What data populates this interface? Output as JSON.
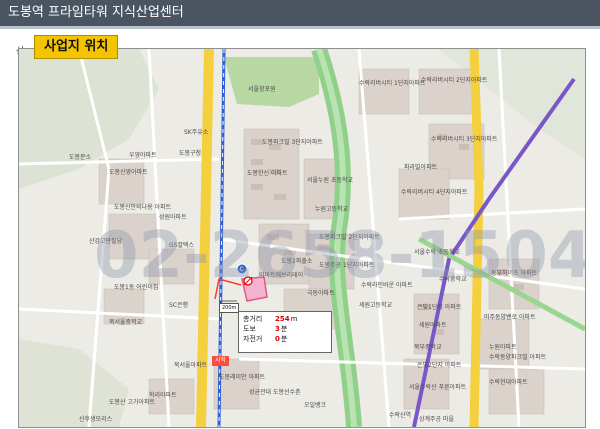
{
  "header": {
    "title": "도봉역 프라임타워 지식산업센터",
    "section_label": "사업지 위치",
    "frame_label": "상"
  },
  "map": {
    "watermark": "02-2658-1504",
    "scale_label": "200m",
    "start_label": "시작",
    "colors": {
      "stream": "#8fd08a",
      "main_road": "#f4d03f",
      "subway_line": "#7a57c8",
      "rail_line": "#2d5fd6",
      "site": "#e0568f"
    },
    "labels": {
      "park": "서울창포원",
      "apt_top_right_1": "수락리버시티 1단지아파트",
      "apt_top_right_2": "수락리버시티 2단지아파트",
      "apt_right_3": "수락리버시티 3단지아파트",
      "apt_right_4": "수락리버시티 4단지아파트",
      "park_apt": "파라빌아파트",
      "school_right": "서울수락 초등학교",
      "dobong_pakr": "도봉파크빌 3단지아파트",
      "dobong_hanshin": "도봉한신 아파트",
      "seoul_dobong": "서울누원 초등학교",
      "nuwon_high": "누원고등학교",
      "dobong_park2": "도봉파크빌 2단지아파트",
      "dobong_station": "도봉2파출소",
      "dobong_jugong": "도봉주공 1단지아파트",
      "emart": "이마트에브리데이",
      "geukdong": "극동아파트",
      "uyeon": "우영아파트",
      "dobong_gu": "도봉구청",
      "sk": "SK주유소",
      "dobong_sinyeong": "도봉신영아파트",
      "dobong_meadow": "도봉신안비나용 아파트",
      "seongwon": "성원아파트",
      "gs": "GS칼텍스",
      "sanggye": "산강고판필당",
      "dobong1": "도봉1동 어린이집",
      "sc": "SC은행",
      "bukseoul": "북서울중학교",
      "bukseoul_apt": "북서울아파트",
      "dobong_rail": "도봉래미안 아파트",
      "hakrin": "학리아파트",
      "seonggyun": "성균관대 도봉선수촌",
      "ojoo": "오일뱅크",
      "seoul_suraksan": "서울수락산 푸른아파트",
      "bukbong": "북부중학교",
      "suraksan_hyundai": "수락현대아파트",
      "sura_elementary": "수락중학교",
      "mi_dong": "미주동양밴로 아파트",
      "dong_bu": "동부하이츠 아파트",
      "sura_bb": "수락라인바운 아파트",
      "sewon": "세원아파트",
      "sewon_high": "세원고등학교",
      "eunbit_apt": "은빛1단지 아파트",
      "eunbit2": "은빛2단지 아파트",
      "sangbong": "수락동양파크빌 아파트",
      "suraksan_ok": "수락산역",
      "nukdong": "누원아파트",
      "sanggye_bottom": "상계주공 마을",
      "sanggye_moradang": "산후생모리스",
      "gung_station": "도봉산 고가아파트",
      "dobong_bunseo": "도봉분소",
      "sc_station": "SC은행"
    },
    "info": {
      "distance_key": "총거리",
      "distance_val": "254",
      "distance_unit": "m",
      "walk_key": "도보",
      "walk_val": "3",
      "walk_unit": "분",
      "bike_key": "자전거",
      "bike_val": "0",
      "bike_unit": "분"
    }
  }
}
